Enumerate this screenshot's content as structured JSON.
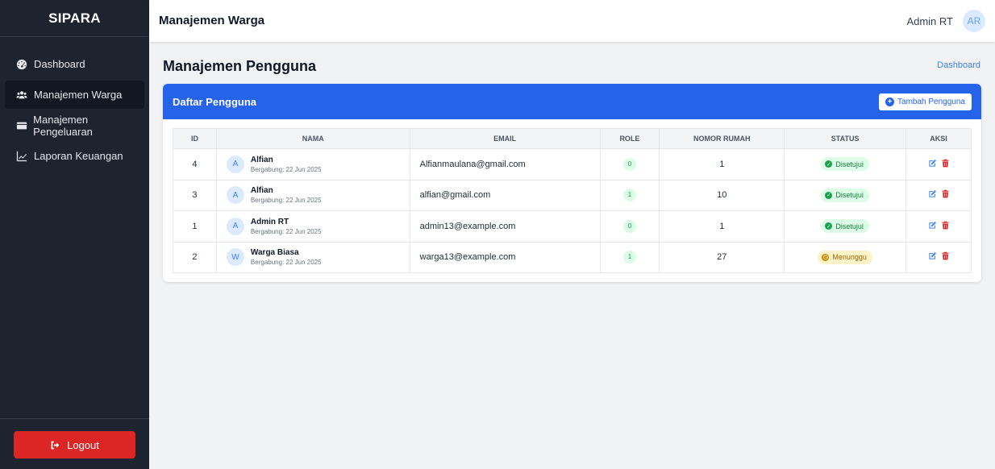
{
  "sidebar": {
    "brand": "SIPARA",
    "items": [
      {
        "label": "Dashboard",
        "icon": "dashboard-icon"
      },
      {
        "label": "Manajemen Warga",
        "icon": "users-icon",
        "active": true
      },
      {
        "label": "Manajemen Pengeluaran",
        "icon": "wallet-icon"
      },
      {
        "label": "Laporan Keuangan",
        "icon": "chart-line-icon"
      }
    ],
    "logout_label": "Logout"
  },
  "header": {
    "title": "Manajemen Warga",
    "user_name": "Admin RT",
    "avatar_initials": "AR"
  },
  "main": {
    "page_title": "Manajemen Pengguna",
    "breadcrumb": "Dashboard",
    "card_title": "Daftar Pengguna",
    "add_button_label": "Tambah Pengguna",
    "columns": [
      "ID",
      "NAMA",
      "EMAIL",
      "ROLE",
      "NOMOR RUMAH",
      "STATUS",
      "AKSI"
    ],
    "rows": [
      {
        "id": "4",
        "initial": "A",
        "name": "Alfian",
        "joined": "Bergabung: 22 Jun 2025",
        "email": "Alfianmaulana@gmail.com",
        "role": "0",
        "house": "1",
        "status": "Disetujui",
        "status_type": "ok"
      },
      {
        "id": "3",
        "initial": "A",
        "name": "Alfian",
        "joined": "Bergabung: 22 Jun 2025",
        "email": "alfian@gmail.com",
        "role": "1",
        "house": "10",
        "status": "Disetujui",
        "status_type": "ok"
      },
      {
        "id": "1",
        "initial": "A",
        "name": "Admin RT",
        "joined": "Bergabung: 22 Jun 2025",
        "email": "admin13@example.com",
        "role": "0",
        "house": "1",
        "status": "Disetujui",
        "status_type": "ok"
      },
      {
        "id": "2",
        "initial": "W",
        "name": "Warga Biasa",
        "joined": "Bergabung: 22 Jun 2025",
        "email": "warga13@example.com",
        "role": "1",
        "house": "27",
        "status": "Menunggu",
        "status_type": "wait"
      }
    ]
  },
  "colors": {
    "sidebar_bg": "#1e2330",
    "accent": "#2563eb",
    "logout": "#dc2626",
    "approved": "#16a34a",
    "pending": "#ca8a04",
    "delete": "#dc2626"
  }
}
